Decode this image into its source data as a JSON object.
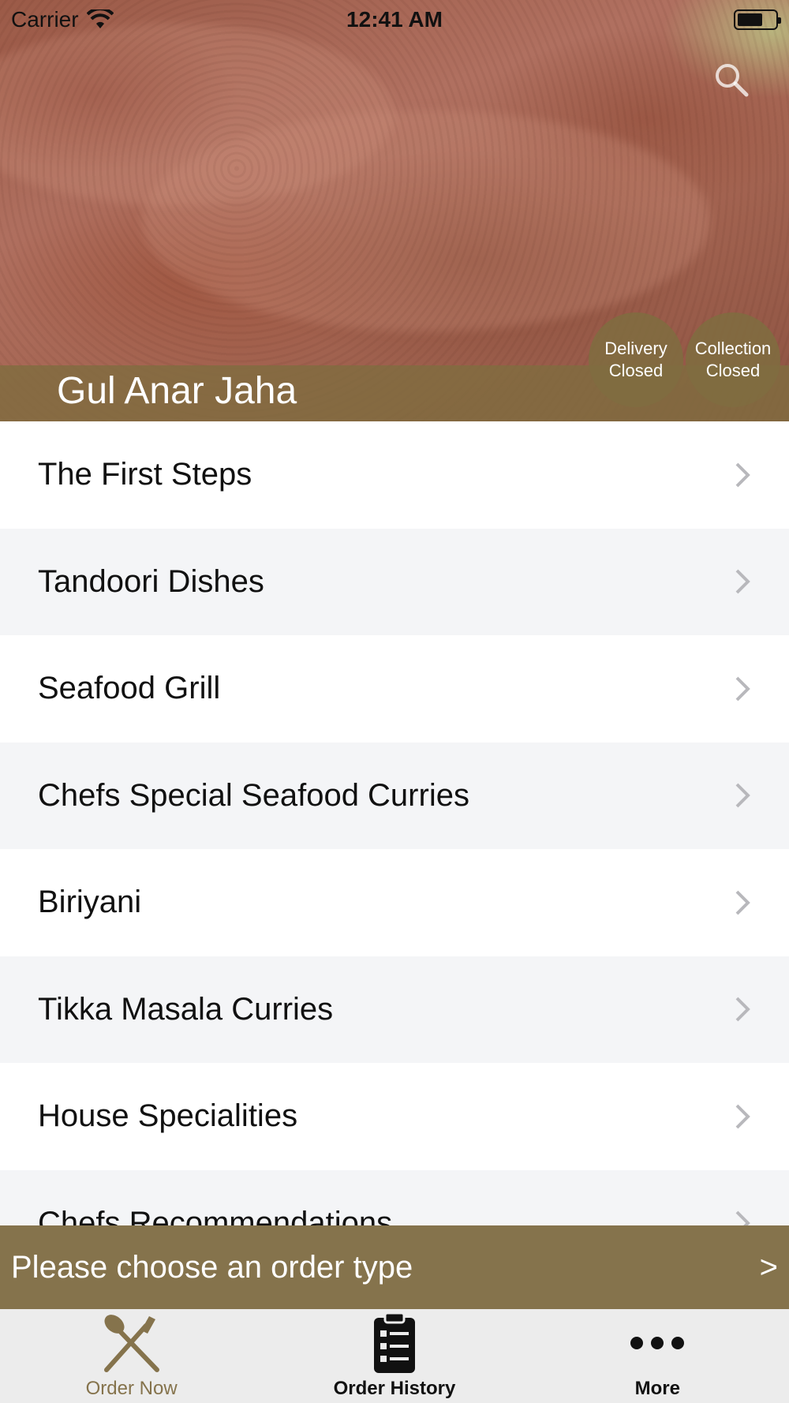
{
  "status_bar": {
    "carrier": "Carrier",
    "time": "12:41 AM"
  },
  "header": {
    "restaurant_name": "Gul Anar Jaha",
    "delivery_badge": {
      "line1": "Delivery",
      "line2": "Closed"
    },
    "collection_badge": {
      "line1": "Collection",
      "line2": "Closed"
    },
    "search_icon": "search-icon"
  },
  "menu": {
    "categories": [
      {
        "label": "The First Steps"
      },
      {
        "label": "Tandoori Dishes"
      },
      {
        "label": "Seafood Grill"
      },
      {
        "label": "Chefs Special Seafood Curries"
      },
      {
        "label": "Biriyani"
      },
      {
        "label": "Tikka Masala Curries"
      },
      {
        "label": "House Specialities"
      },
      {
        "label": "Chefs Recommendations"
      }
    ]
  },
  "order_banner": {
    "label": "Please choose an order type",
    "arrow": ">"
  },
  "tabs": [
    {
      "label": "Order Now",
      "icon": "fork-knife-icon",
      "active": true
    },
    {
      "label": "Order History",
      "icon": "clipboard-list-icon",
      "active": false
    },
    {
      "label": "More",
      "icon": "ellipsis-icon",
      "active": false
    }
  ],
  "colors": {
    "accent": "#85734c",
    "row_alt": "#f4f5f7",
    "tabbar": "#ececec"
  }
}
